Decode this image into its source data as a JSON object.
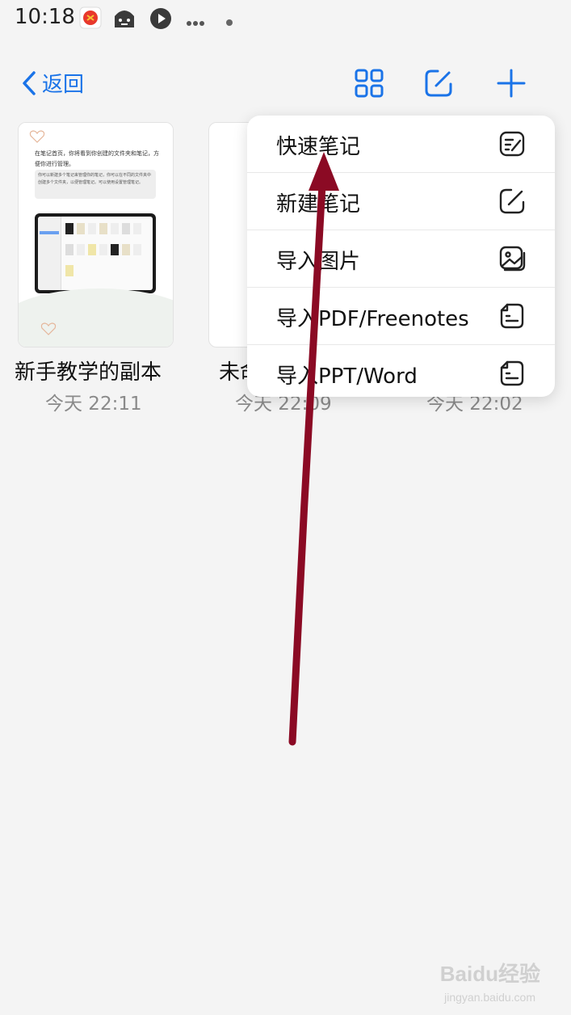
{
  "status_bar": {
    "time": "10:18",
    "icons": [
      "app-red-icon",
      "robot-icon",
      "play-icon",
      "more-dots-icon",
      "dot-icon"
    ]
  },
  "nav": {
    "back_label": "返回",
    "icons": [
      "grid-view-icon",
      "edit-note-icon",
      "add-icon"
    ],
    "accent_color": "#1a73e8"
  },
  "documents": [
    {
      "title": "新手教学的副本",
      "date": "今天 22:11"
    },
    {
      "title": "未命",
      "date": "今天 22:09"
    },
    {
      "title": "",
      "date": "今天 22:02"
    }
  ],
  "thumbnail": {
    "heading": "在笔记首页，你将看到你创建的文件夹和笔记，方便你进行管理。",
    "body": "你可以新建多个笔记来管理你的笔记，你可以在不同的文件夹中创建多个文件夹，以便管理笔记。可以使用设置管理笔记。"
  },
  "menu": {
    "items": [
      {
        "label": "快速笔记",
        "icon": "quick-note-icon"
      },
      {
        "label": "新建笔记",
        "icon": "new-note-icon"
      },
      {
        "label": "导入图片",
        "icon": "image-icon"
      },
      {
        "label": "导入PDF/Freenotes",
        "icon": "import-doc-icon"
      },
      {
        "label": "导入PPT/Word",
        "icon": "import-doc-icon"
      }
    ]
  },
  "annotation": {
    "arrow_color": "#8b0a24"
  },
  "watermark": {
    "brand": "Baidu经验",
    "url": "jingyan.baidu.com"
  }
}
